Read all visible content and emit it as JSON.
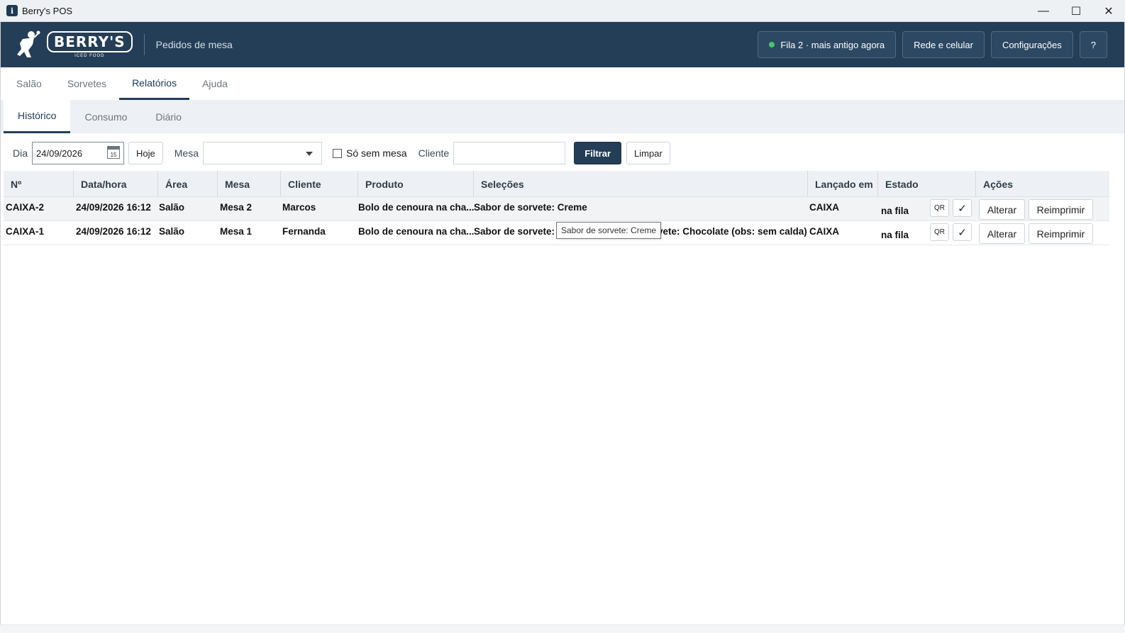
{
  "window": {
    "title": "Berry's POS",
    "app_icon": "berrys-app-icon",
    "controls": {
      "minimize": "—",
      "maximize": "☐",
      "close": "✕"
    }
  },
  "header": {
    "brand": "BERRY'S",
    "brand_sub": "ICED FOOD",
    "subtitle": "Pedidos de mesa",
    "status_label": "Fila 2 · mais antigo agora",
    "status_color": "#4cc36a",
    "network_label": "Rede e celular",
    "settings_label": "Configurações",
    "help_label": "?"
  },
  "main_tabs": [
    {
      "label": "Salão",
      "active": false
    },
    {
      "label": "Sorvetes",
      "active": false
    },
    {
      "label": "Relatórios",
      "active": true
    },
    {
      "label": "Ajuda",
      "active": false
    }
  ],
  "sub_tabs": [
    {
      "label": "Histórico",
      "active": true
    },
    {
      "label": "Consumo",
      "active": false
    },
    {
      "label": "Diário",
      "active": false
    }
  ],
  "filters": {
    "day_label": "Dia",
    "day_value": "24/09/2026",
    "calendar_day": "15",
    "today_label": "Hoje",
    "table_label": "Mesa",
    "table_value": "",
    "no_table_label": "Só sem mesa",
    "no_table_checked": false,
    "client_label": "Cliente",
    "client_value": "",
    "filter_label": "Filtrar",
    "clear_label": "Limpar"
  },
  "table": {
    "columns": [
      "Nº",
      "Data/hora",
      "Área",
      "Mesa",
      "Cliente",
      "Produto",
      "Seleções",
      "Lançado em",
      "Estado",
      "Ações"
    ],
    "rows": [
      {
        "num": "CAIXA-2",
        "datetime": "24/09/2026 16:12",
        "area": "Salão",
        "table": "Mesa 2",
        "client": "Marcos",
        "product": "Bolo de cenoura na cha...",
        "selections": "Sabor de sorvete: Creme",
        "launched": "CAIXA",
        "state": "na fila",
        "qr": "QR",
        "check": "✓",
        "edit": "Alterar",
        "reprint": "Reimprimir"
      },
      {
        "num": "CAIXA-1",
        "datetime": "24/09/2026 16:12",
        "area": "Salão",
        "table": "Mesa 1",
        "client": "Fernanda",
        "product": "Bolo de cenoura na cha...",
        "selections": "Sabor de sorvete: Creme, Sabor de sorvete: Chocolate (obs: sem calda)",
        "selections_visible_start": "Sabor de sorvete: ",
        "selections_visible_end": "vete: Chocolate (obs: sem calda)",
        "launched": "CAIXA",
        "state": "na fila",
        "qr": "QR",
        "check": "✓",
        "edit": "Alterar",
        "reprint": "Reimprimir"
      }
    ]
  },
  "tooltip": "Sabor de sorvete: Creme"
}
